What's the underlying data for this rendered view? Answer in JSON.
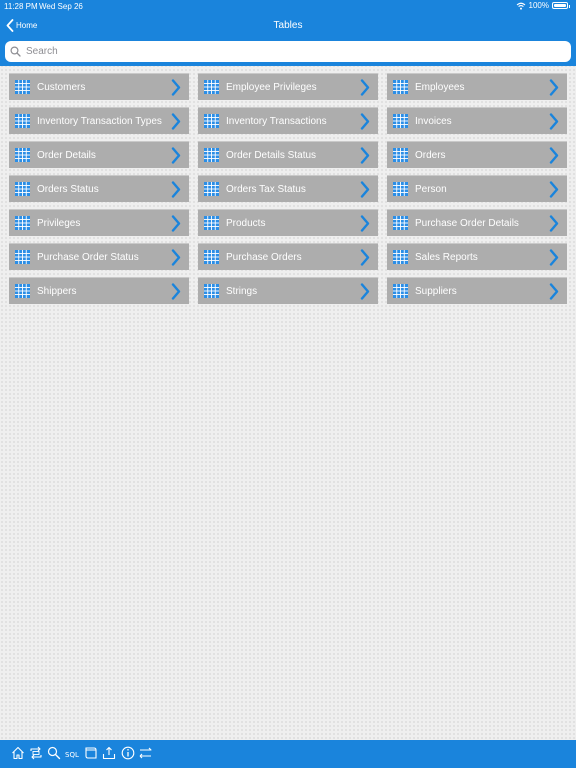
{
  "status": {
    "time": "11:28 PM",
    "date": "Wed Sep 26",
    "battery": "100%"
  },
  "nav": {
    "back_label": "Home",
    "title": "Tables"
  },
  "search": {
    "placeholder": "Search"
  },
  "tables": [
    "Customers",
    "Employee Privileges",
    "Employees",
    "Inventory Transaction Types",
    "Inventory Transactions",
    "Invoices",
    "Order Details",
    "Order Details Status",
    "Orders",
    "Orders Status",
    "Orders Tax Status",
    "Person",
    "Privileges",
    "Products",
    "Purchase Order Details",
    "Purchase Order Status",
    "Purchase Orders",
    "Sales Reports",
    "Shippers",
    "Strings",
    "Suppliers"
  ],
  "toolbar": {
    "icons": [
      "home-icon",
      "sync-icon",
      "search-icon",
      "sql-icon",
      "script-icon",
      "export-icon",
      "info-icon",
      "transfer-icon"
    ],
    "sql_label": "SQL"
  },
  "colors": {
    "accent": "#1a84dc",
    "row": "#adadad",
    "icon": "#2b8ee6"
  }
}
